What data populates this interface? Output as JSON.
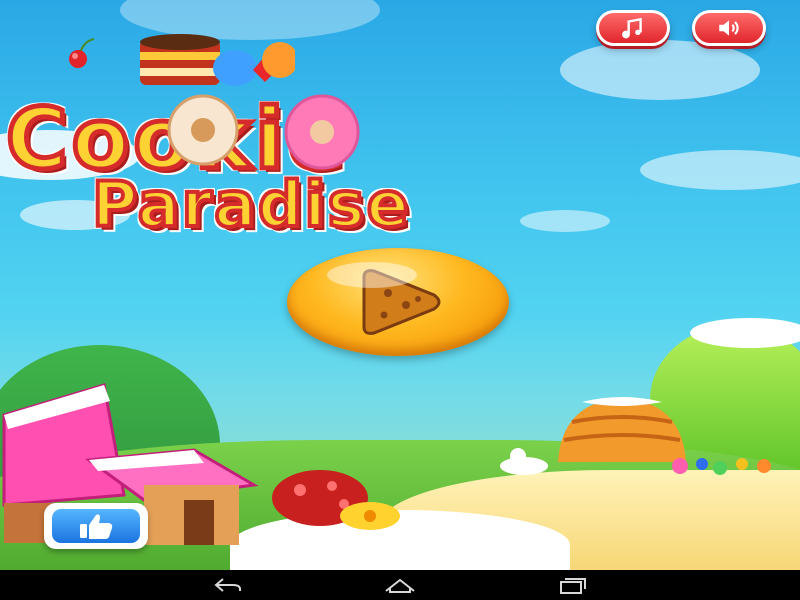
{
  "game": {
    "title_line1": "Cookie",
    "title_line2": "Paradise"
  },
  "top_buttons": {
    "music_icon": "music-note-icon",
    "sound_icon": "speaker-icon"
  },
  "play_button": {
    "icon": "play-triangle-icon"
  },
  "like_button": {
    "icon": "thumbs-up-icon"
  },
  "navigation_bar": {
    "buttons": [
      "back-icon",
      "home-icon",
      "recent-apps-icon"
    ]
  },
  "colors": {
    "accent_red": "#e0262d",
    "title_yellow": "#ffd233",
    "play_orange": "#f5a000",
    "like_blue": "#1b74e0"
  }
}
